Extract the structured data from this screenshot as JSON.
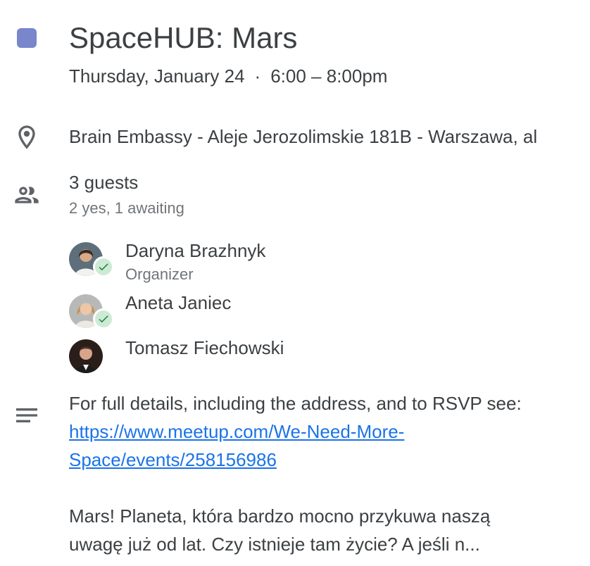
{
  "event": {
    "title": "SpaceHUB: Mars",
    "date": "Thursday, January 24",
    "separator": "·",
    "time": "6:00 – 8:00pm",
    "color": "#7986cb"
  },
  "location": {
    "icon": "location-pin-icon",
    "text": "Brain Embassy - Aleje Jerozolimskie 181B - Warszawa, al"
  },
  "guests": {
    "icon": "people-icon",
    "count_label": "3 guests",
    "summary": "2 yes, 1 awaiting",
    "list": [
      {
        "name": "Daryna Brazhnyk",
        "role": "Organizer",
        "status": "yes"
      },
      {
        "name": "Aneta Janiec",
        "role": "",
        "status": "yes"
      },
      {
        "name": "Tomasz Fiechowski",
        "role": "",
        "status": "awaiting"
      }
    ]
  },
  "description": {
    "icon": "notes-icon",
    "intro": "For full details, including the address, and to RSVP see:",
    "link_line1": "https://www.meetup.com/We-Need-More-",
    "link_line2": "Space/events/258156986",
    "body_line1": "Mars! Planeta, która bardzo mocno przykuwa naszą",
    "body_line2": "uwagę już od lat. Czy istnieje tam życie? A jeśli n..."
  },
  "colors": {
    "text": "#3c4043",
    "secondary": "#70757a",
    "link": "#1a73e8",
    "accepted_badge": "#ceead6",
    "check": "#188038"
  }
}
